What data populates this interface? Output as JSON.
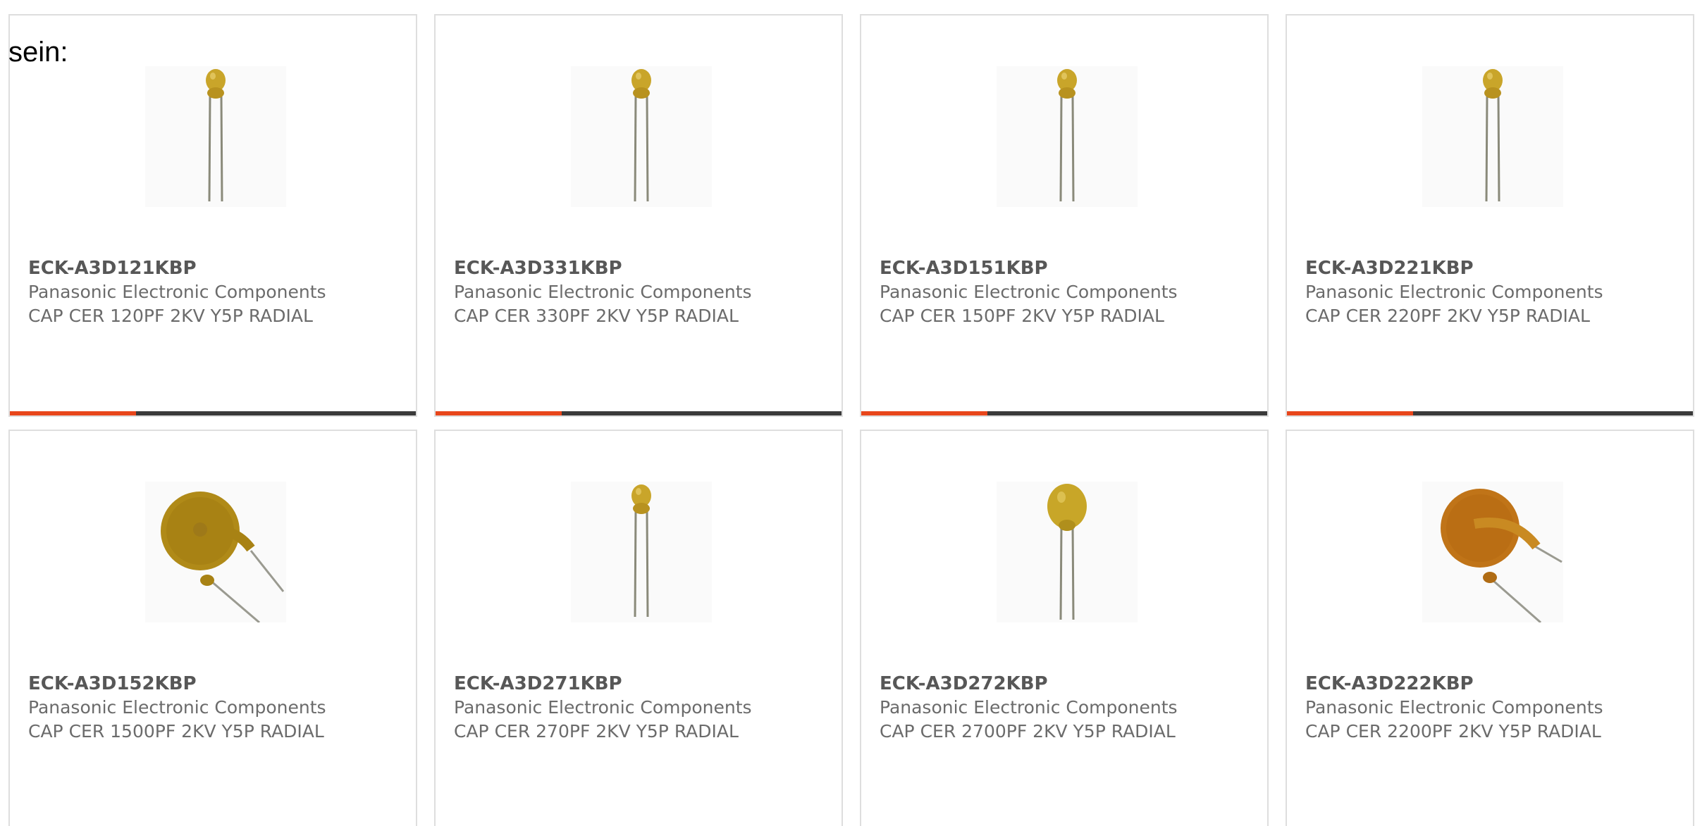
{
  "intro_text": "sein:",
  "colors": {
    "progress_active": "#e8461b",
    "progress_track": "#3a3a3a",
    "card_border": "#dedede",
    "text": "#6b6b6b"
  },
  "products": [
    {
      "part_number": "ECK-A3D121KBP",
      "manufacturer": "Panasonic Electronic Components",
      "description": "CAP CER 120PF 2KV Y5P RADIAL",
      "image": "small-ceramic-capacitor",
      "progress": 0.31
    },
    {
      "part_number": "ECK-A3D331KBP",
      "manufacturer": "Panasonic Electronic Components",
      "description": "CAP CER 330PF 2KV Y5P RADIAL",
      "image": "small-ceramic-capacitor",
      "progress": 0.31
    },
    {
      "part_number": "ECK-A3D151KBP",
      "manufacturer": "Panasonic Electronic Components",
      "description": "CAP CER 150PF 2KV Y5P RADIAL",
      "image": "small-ceramic-capacitor",
      "progress": 0.31
    },
    {
      "part_number": "ECK-A3D221KBP",
      "manufacturer": "Panasonic Electronic Components",
      "description": "CAP CER 220PF 2KV Y5P RADIAL",
      "image": "small-ceramic-capacitor",
      "progress": 0.31
    },
    {
      "part_number": "ECK-A3D152KBP",
      "manufacturer": "Panasonic Electronic Components",
      "description": "CAP CER 1500PF 2KV Y5P RADIAL",
      "image": "large-disc-capacitor",
      "progress": null
    },
    {
      "part_number": "ECK-A3D271KBP",
      "manufacturer": "Panasonic Electronic Components",
      "description": "CAP CER 270PF 2KV Y5P RADIAL",
      "image": "small-ceramic-capacitor",
      "progress": null
    },
    {
      "part_number": "ECK-A3D272KBP",
      "manufacturer": "Panasonic Electronic Components",
      "description": "CAP CER 2700PF 2KV Y5P RADIAL",
      "image": "medium-ceramic-capacitor",
      "progress": null
    },
    {
      "part_number": "ECK-A3D222KBP",
      "manufacturer": "Panasonic Electronic Components",
      "description": "CAP CER 2200PF 2KV Y5P RADIAL",
      "image": "large-orange-disc-capacitor",
      "progress": null
    }
  ]
}
